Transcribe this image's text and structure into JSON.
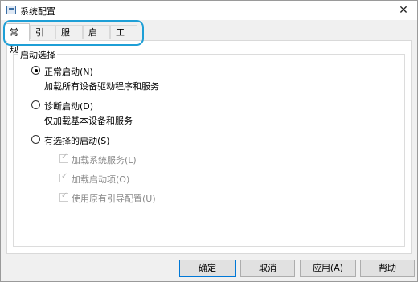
{
  "window": {
    "title": "系统配置",
    "close_glyph": "✕"
  },
  "tabs": [
    {
      "label": "常规"
    },
    {
      "label": "引导"
    },
    {
      "label": "服务"
    },
    {
      "label": "启动"
    },
    {
      "label": "工具"
    }
  ],
  "startup_selection": {
    "group_label": "启动选择",
    "normal": {
      "label": "正常启动(N)",
      "desc": "加载所有设备驱动程序和服务"
    },
    "diagnostic": {
      "label": "诊断启动(D)",
      "desc": "仅加载基本设备和服务"
    },
    "selective": {
      "label": "有选择的启动(S)",
      "options": [
        {
          "label": "加载系统服务(L)"
        },
        {
          "label": "加载启动项(O)"
        },
        {
          "label": "使用原有引导配置(U)"
        }
      ]
    }
  },
  "buttons": {
    "ok": "确定",
    "cancel": "取消",
    "apply": "应用(A)",
    "help": "帮助"
  },
  "highlight_color": "#1e9fd6"
}
